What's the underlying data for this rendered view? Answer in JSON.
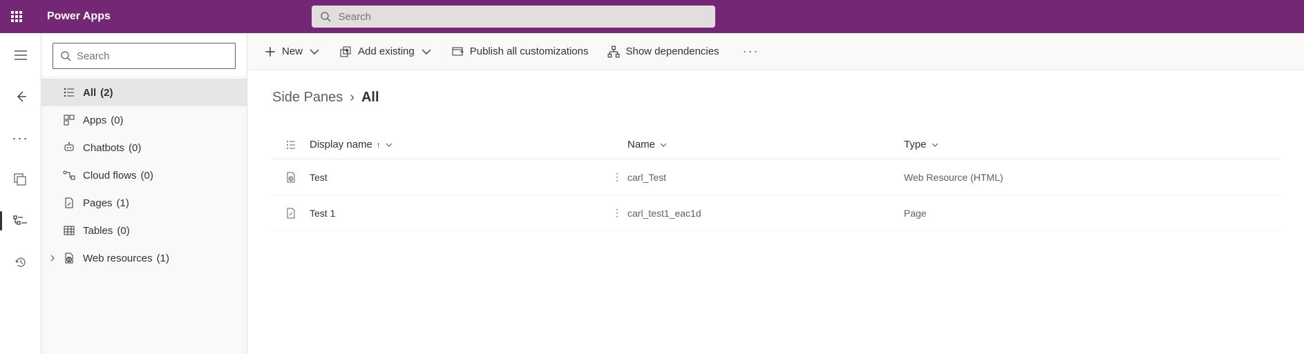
{
  "header": {
    "brand": "Power Apps",
    "search_placeholder": "Search"
  },
  "sidebar": {
    "search_placeholder": "Search",
    "items": [
      {
        "label": "All",
        "count": "(2)",
        "selected": true
      },
      {
        "label": "Apps",
        "count": "(0)"
      },
      {
        "label": "Chatbots",
        "count": "(0)"
      },
      {
        "label": "Cloud flows",
        "count": "(0)"
      },
      {
        "label": "Pages",
        "count": "(1)"
      },
      {
        "label": "Tables",
        "count": "(0)"
      },
      {
        "label": "Web resources",
        "count": "(1)",
        "expandable": true
      }
    ]
  },
  "commands": {
    "new": "New",
    "add_existing": "Add existing",
    "publish": "Publish all customizations",
    "dependencies": "Show dependencies"
  },
  "breadcrumb": {
    "root": "Side Panes",
    "current": "All"
  },
  "table": {
    "headers": {
      "display": "Display name",
      "name": "Name",
      "type": "Type"
    },
    "rows": [
      {
        "display": "Test",
        "name": "carl_Test",
        "type": "Web Resource (HTML)",
        "icon": "webresource"
      },
      {
        "display": "Test 1",
        "name": "carl_test1_eac1d",
        "type": "Page",
        "icon": "page"
      }
    ]
  }
}
